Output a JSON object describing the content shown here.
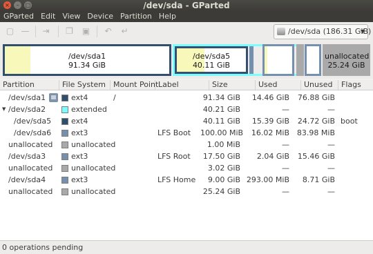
{
  "window": {
    "title": "/dev/sda - GParted"
  },
  "menubar": {
    "items": [
      "GParted",
      "Edit",
      "View",
      "Device",
      "Partition",
      "Help"
    ]
  },
  "device_selector": {
    "value": "/dev/sda  (186.31 GiB)"
  },
  "disk_map": {
    "sda1": {
      "name": "/dev/sda1",
      "size": "91.34 GiB"
    },
    "sda5": {
      "name": "/dev/sda5",
      "size": "40.11 GiB"
    },
    "unalloc": {
      "name": "unallocated",
      "size": "25.24 GiB"
    }
  },
  "table": {
    "headers": [
      "Partition",
      "File System",
      "Mount Point",
      "Label",
      "Size",
      "Used",
      "Unused",
      "Flags"
    ],
    "rows": [
      {
        "partition": "/dev/sda1",
        "fs": "ext4",
        "mount": "/",
        "label": "",
        "size": "91.34 GiB",
        "used": "14.46 GiB",
        "unused": "76.88 GiB",
        "flags": ""
      },
      {
        "partition": "/dev/sda2",
        "fs": "extended",
        "mount": "",
        "label": "",
        "size": "40.21 GiB",
        "used": "—",
        "unused": "—",
        "flags": ""
      },
      {
        "partition": "/dev/sda5",
        "fs": "ext4",
        "mount": "",
        "label": "",
        "size": "40.11 GiB",
        "used": "15.39 GiB",
        "unused": "24.72 GiB",
        "flags": "boot"
      },
      {
        "partition": "/dev/sda6",
        "fs": "ext3",
        "mount": "",
        "label": "LFS Boot",
        "size": "100.00 MiB",
        "used": "16.02 MiB",
        "unused": "83.98 MiB",
        "flags": ""
      },
      {
        "partition": "unallocated",
        "fs": "unallocated",
        "mount": "",
        "label": "",
        "size": "1.00 MiB",
        "used": "—",
        "unused": "—",
        "flags": ""
      },
      {
        "partition": "/dev/sda3",
        "fs": "ext3",
        "mount": "",
        "label": "LFS Root",
        "size": "17.50 GiB",
        "used": "2.04 GiB",
        "unused": "15.46 GiB",
        "flags": ""
      },
      {
        "partition": "unallocated",
        "fs": "unallocated",
        "mount": "",
        "label": "",
        "size": "3.02 GiB",
        "used": "—",
        "unused": "—",
        "flags": ""
      },
      {
        "partition": "/dev/sda4",
        "fs": "ext3",
        "mount": "",
        "label": "LFS Home",
        "size": "9.00 GiB",
        "used": "293.00 MiB",
        "unused": "8.71 GiB",
        "flags": ""
      },
      {
        "partition": "unallocated",
        "fs": "unallocated",
        "mount": "",
        "label": "",
        "size": "25.24 GiB",
        "used": "—",
        "unused": "—",
        "flags": ""
      }
    ]
  },
  "colors": {
    "ext4": "#314e6c",
    "extended": "#7dfcfe",
    "ext3": "#7590ae",
    "unallocated": "#a9a9a9",
    "used": "#f8f8ba"
  },
  "icons": [
    "new-icon",
    "delete-icon",
    "resize-move-icon",
    "copy-icon",
    "paste-icon",
    "undo-icon",
    "apply-icon",
    "disk-icon",
    "lock-icon"
  ],
  "statusbar": {
    "text": "0 operations pending"
  }
}
